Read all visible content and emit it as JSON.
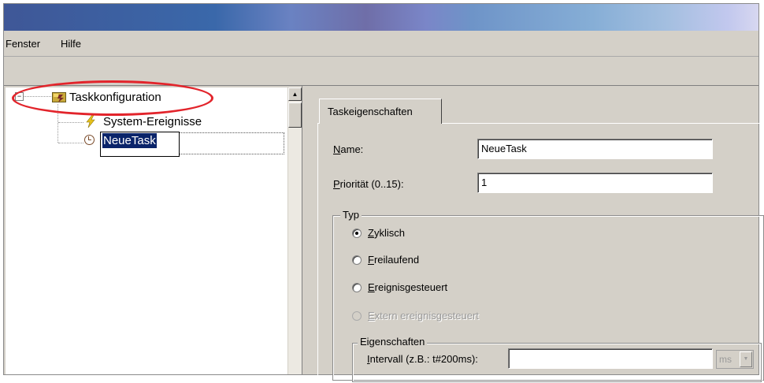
{
  "menu": {
    "items": [
      "Fenster",
      "Hilfe"
    ]
  },
  "tree": {
    "root": {
      "label": "Taskkonfiguration",
      "expander": "−"
    },
    "children": [
      {
        "label": "System-Ereignisse",
        "icon": "lightning-icon"
      },
      {
        "label": "NeueTask",
        "icon": "clock-icon",
        "editing": true
      }
    ]
  },
  "tabs": {
    "active": "Taskeigenschaften"
  },
  "form": {
    "name": {
      "label_access": "N",
      "label_rest": "ame:",
      "value": "NeueTask"
    },
    "priority": {
      "label_access": "P",
      "label_rest": "riorität (0..15):",
      "value": "1"
    },
    "type_group": {
      "title": "Typ",
      "options": [
        {
          "access": "Z",
          "rest": "yklisch",
          "checked": true,
          "enabled": true
        },
        {
          "access": "F",
          "rest": "reilaufend",
          "checked": false,
          "enabled": true
        },
        {
          "access": "E",
          "rest": "reignisgesteuert",
          "checked": false,
          "enabled": true
        },
        {
          "access": "E",
          "rest": "xtern ereignisgesteuert",
          "checked": false,
          "enabled": false
        }
      ]
    },
    "properties_group": {
      "title": "Eigenschaften",
      "interval": {
        "label_access": "I",
        "label_rest": "ntervall (z.B.: t#200ms):",
        "value": "",
        "unit": "ms"
      }
    }
  },
  "colors": {
    "highlight_ellipse": "#e2242b",
    "selection": "#0a246a",
    "window_bg": "#d4d0c8"
  }
}
